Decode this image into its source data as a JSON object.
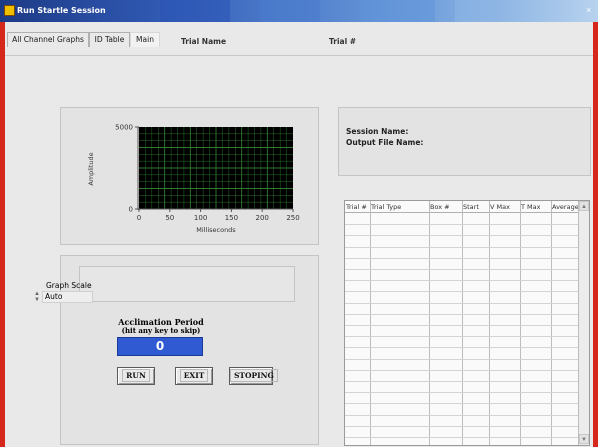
{
  "window": {
    "title": "Run Startle Session",
    "close_icon": "close-icon"
  },
  "tabs": [
    {
      "label": "All Channel Graphs",
      "active": false
    },
    {
      "label": "ID Table",
      "active": false
    },
    {
      "label": "Main",
      "active": true
    }
  ],
  "header": {
    "trial_name_label": "Trial Name",
    "trial_num_label": "Trial #"
  },
  "graph": {
    "ylabel": "Amplitude",
    "xlabel": "Milliseconds",
    "y_ticks": [
      "5000",
      "0"
    ],
    "x_ticks": [
      "0",
      "50",
      "100",
      "150",
      "200",
      "250"
    ],
    "xlim": [
      0,
      250
    ],
    "ylim": [
      0,
      5000
    ],
    "plot_bg": "#000000",
    "grid_color": "#2f7a2f",
    "grid": true
  },
  "graph_scale": {
    "label": "Graph Scale",
    "value": "Auto",
    "stepper_icon": "up-down-arrows-icon"
  },
  "acclimation": {
    "title": "Acclimation Period",
    "hint": "(hit any key to skip)",
    "value": "0",
    "color": "#2f5ad2"
  },
  "buttons": {
    "run": "RUN",
    "exit": "EXIT",
    "stoping": "STOPING"
  },
  "session": {
    "session_name_label": "Session Name:",
    "output_file_label": "Output File  Name:"
  },
  "trial_table": {
    "columns": [
      "Trial #",
      "Trial Type",
      "Box #",
      "Start",
      "V Max",
      "T Max",
      "Average"
    ],
    "rows": []
  }
}
